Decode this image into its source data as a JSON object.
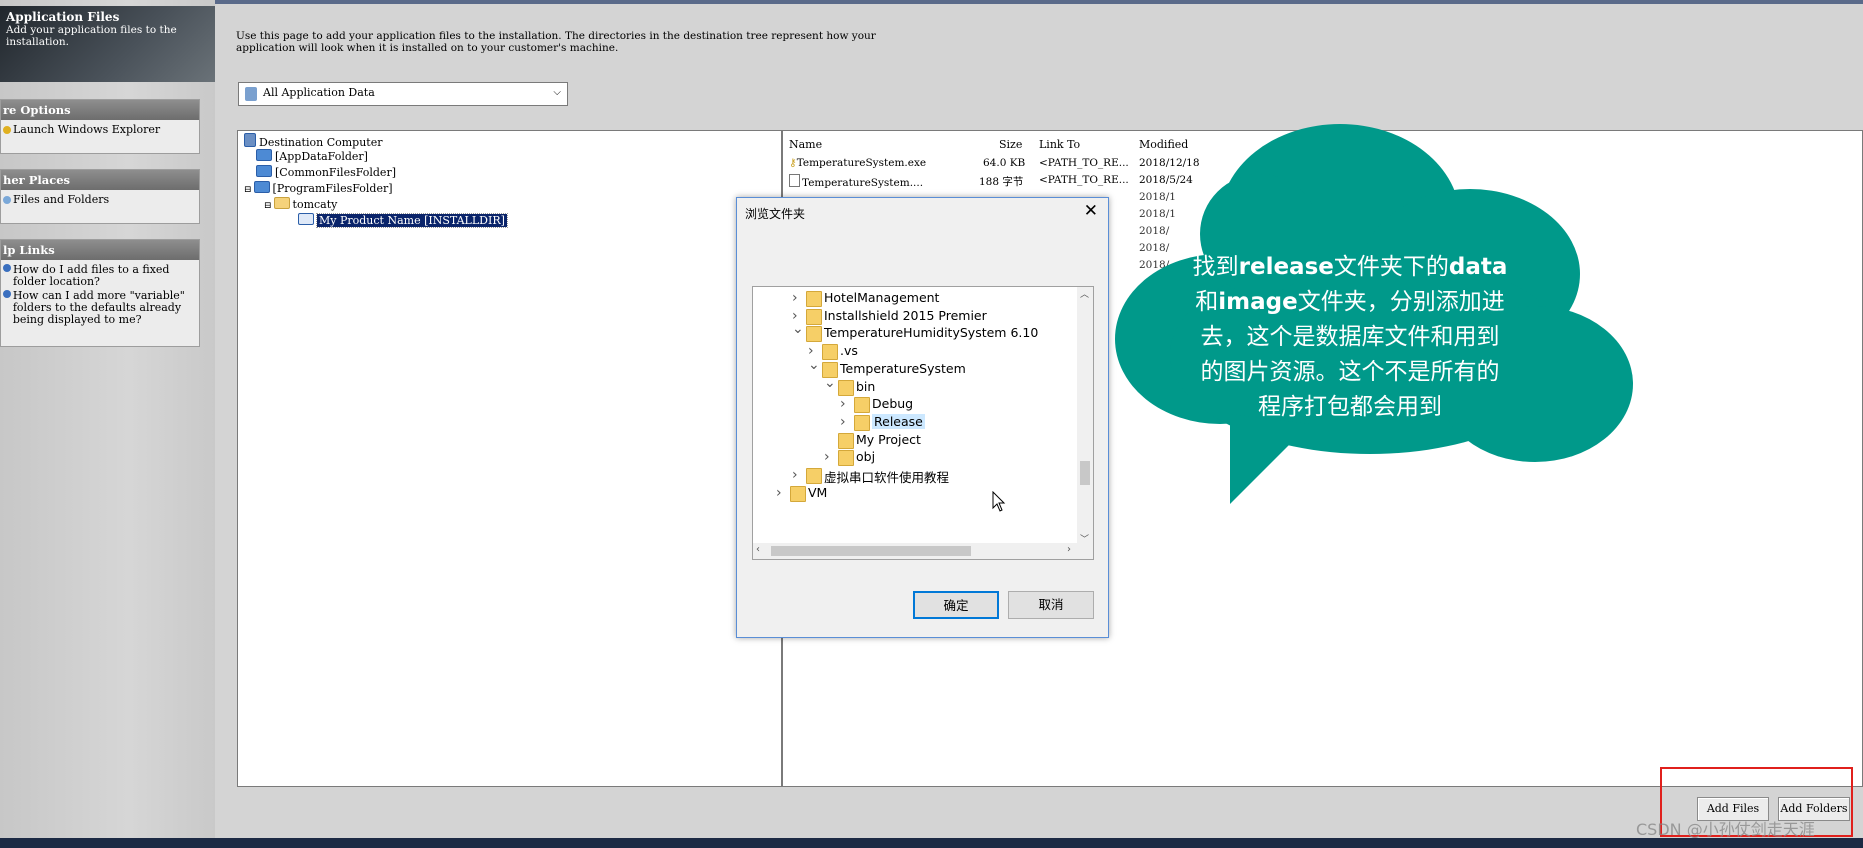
{
  "sidebar": {
    "header_title": "Application Files",
    "header_sub": "Add your application files to the installation.",
    "more_options": {
      "title": "re Options",
      "item": "Launch Windows Explorer"
    },
    "other_places": {
      "title": "her Places",
      "item": "Files and Folders"
    },
    "help_links": {
      "title": "lp Links",
      "item1": "How do I add files to a fixed folder location?",
      "item2": "How can I add more \"variable\" folders to the defaults already being displayed to me?"
    }
  },
  "main": {
    "description": "Use this page to add your application files to the installation. The directories in the destination tree represent how your application will look when it is installed on to your customer's machine.",
    "select_value": "All Application Data",
    "tree": {
      "root": "Destination Computer",
      "app_data": "[AppDataFolder]",
      "common_files": "[CommonFilesFolder]",
      "program_files": "[ProgramFilesFolder]",
      "tomcaty": "tomcaty",
      "product": "My Product Name [INSTALLDIR]"
    },
    "list": {
      "columns": {
        "name": "Name",
        "size": "Size",
        "link": "Link To",
        "modified": "Modified"
      },
      "rows": [
        {
          "name": "TemperatureSystem.exe",
          "size": "64.0 KB",
          "link": "<PATH_TO_RE...",
          "modified": "2018/12/18"
        },
        {
          "name": "TemperatureSystem....",
          "size": "188 字节",
          "link": "<PATH_TO_RE...",
          "modified": "2018/5/24"
        }
      ]
    },
    "add_files": "Add Files",
    "add_folders": "Add Folders"
  },
  "dialog": {
    "title": "浏览文件夹",
    "close": "✕",
    "ok": "确定",
    "cancel": "取消",
    "folders": [
      {
        "label": "HotelManagement",
        "depth": 0,
        "chev": "›"
      },
      {
        "label": "Installshield 2015 Premier",
        "depth": 0,
        "chev": "›"
      },
      {
        "label": "TemperatureHumiditySystem 6.10",
        "depth": 0,
        "chev": "⌄"
      },
      {
        "label": ".vs",
        "depth": 1,
        "chev": "›"
      },
      {
        "label": "TemperatureSystem",
        "depth": 1,
        "chev": "⌄"
      },
      {
        "label": "bin",
        "depth": 2,
        "chev": "⌄"
      },
      {
        "label": "Debug",
        "depth": 3,
        "chev": "›"
      },
      {
        "label": "Release",
        "depth": 3,
        "chev": "›"
      },
      {
        "label": "My Project",
        "depth": 2,
        "chev": ""
      },
      {
        "label": "obj",
        "depth": 2,
        "chev": "›"
      },
      {
        "label": "虚拟串口软件使用教程",
        "depth": 0,
        "chev": "›"
      },
      {
        "label": "VM",
        "depth": -1,
        "chev": "›"
      }
    ]
  },
  "callout": {
    "l1a": "找到",
    "l1b": "release",
    "l1c": "文件夹下的",
    "l1d": "data",
    "l2a": "和",
    "l2b": "image",
    "l2c": "文件夹，分别添加进",
    "l3": "去，这个是数据库文件和用到",
    "l4": "的图片资源。这个不是所有的",
    "l5": "程序打包都会用到"
  },
  "watermark": "CSDN @小孙仗剑走天涯",
  "colors": {
    "callout": "#00998a",
    "highlight_border": "#e0201c",
    "selection": "#0a246a"
  }
}
